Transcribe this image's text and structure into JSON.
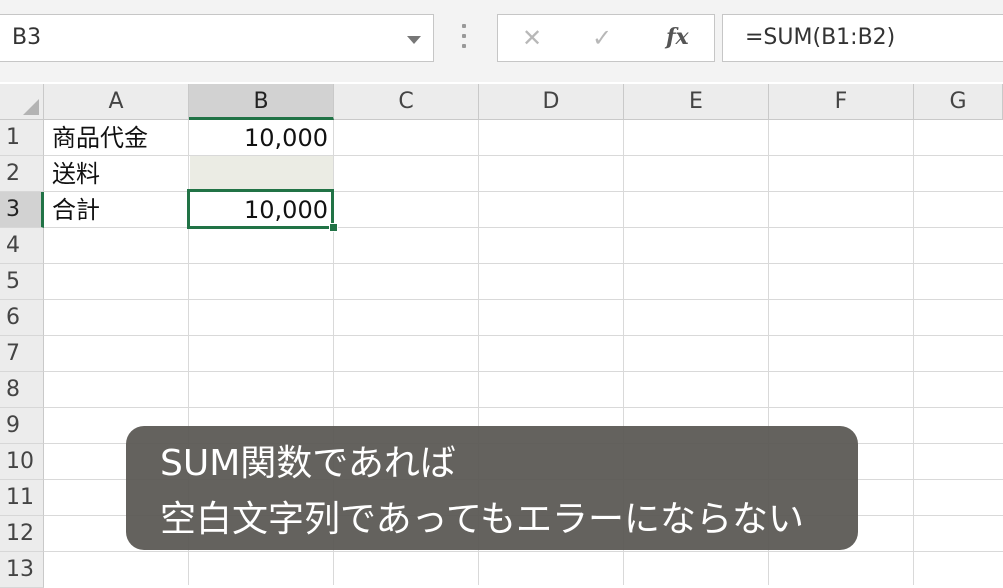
{
  "formula_bar": {
    "name_box": "B3",
    "cancel_icon": "✕",
    "enter_icon": "✓",
    "function_icon": "fx",
    "formula": "=SUM(B1:B2)"
  },
  "columns": [
    "A",
    "B",
    "C",
    "D",
    "E",
    "F",
    "G"
  ],
  "selected_column": "B",
  "rows": [
    "1",
    "2",
    "3",
    "4",
    "5",
    "6",
    "7",
    "8",
    "9",
    "10",
    "11",
    "12",
    "13"
  ],
  "selected_row": "3",
  "cells": {
    "A1": "商品代金",
    "B1": "10,000",
    "A2": "送料",
    "B2": "",
    "A3": "合計",
    "B3": "10,000"
  },
  "selected_cell": "B3",
  "caption": {
    "line1": "SUM関数であれば",
    "line2": "空白文字列であってもエラーにならない"
  },
  "colors": {
    "accent": "#217346",
    "b2_fill": "#ebece4",
    "caption_bg": "#58564f"
  }
}
